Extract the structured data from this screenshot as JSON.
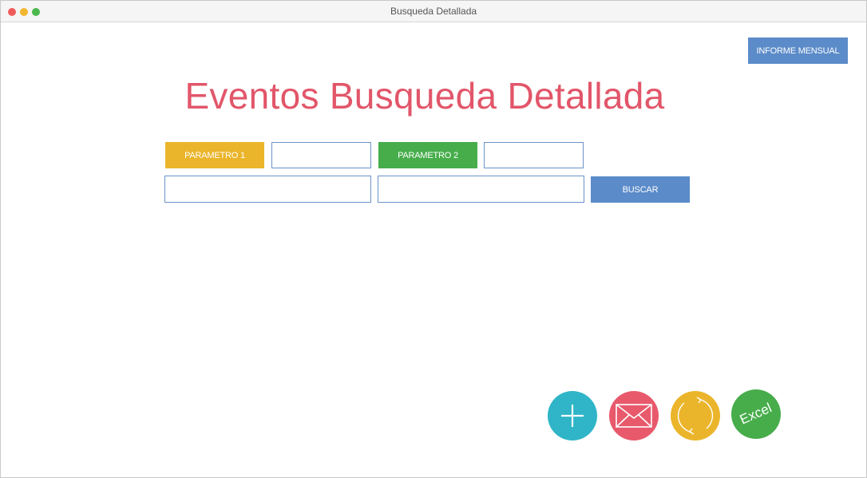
{
  "window": {
    "title": "Busqueda Detallada"
  },
  "header": {
    "report_label": "INFORME MENSUAL"
  },
  "main": {
    "title": "Eventos Busqueda Detallada",
    "param1_label": "PARAMETRO 1",
    "param2_label": "PARAMETRO 2",
    "param1_value": "",
    "param2_value": "",
    "field3_value": "",
    "field4_value": "",
    "search_label": "BUSCAR"
  },
  "actions": {
    "add_icon": "plus-icon",
    "mail_icon": "envelope-icon",
    "refresh_icon": "refresh-icon",
    "excel_label": "Excel"
  },
  "colors": {
    "accent_blue": "#5b8bc9",
    "title_red": "#e2566a",
    "param1_yellow": "#ebb52b",
    "param2_green": "#47ad4b",
    "add_teal": "#2fb5c7",
    "mail_red": "#e8596c"
  }
}
